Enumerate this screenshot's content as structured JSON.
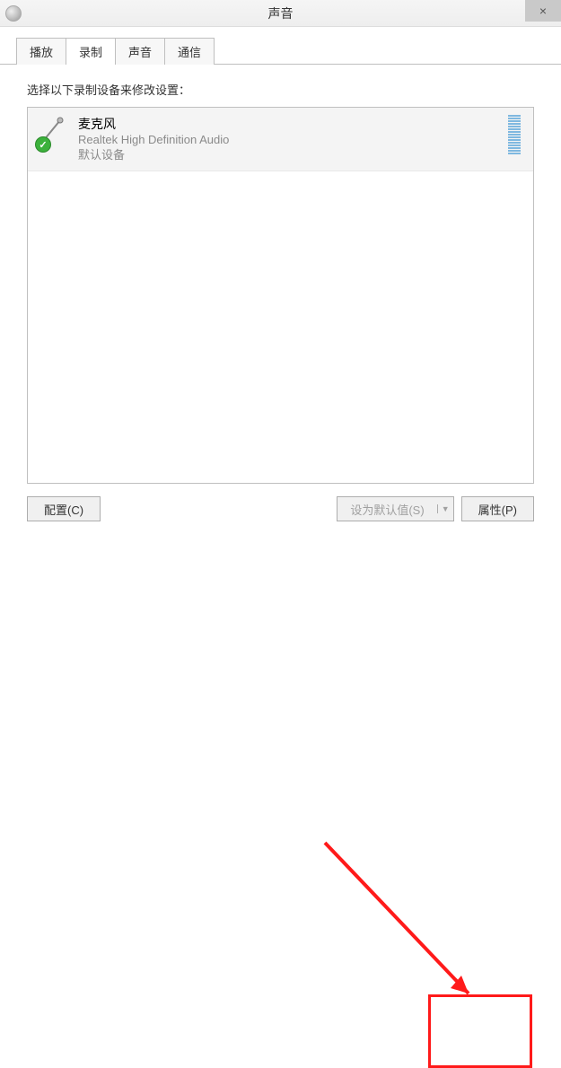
{
  "window": {
    "title": "声音",
    "close_label": "×"
  },
  "tabs": [
    {
      "label": "播放",
      "active": false
    },
    {
      "label": "录制",
      "active": true
    },
    {
      "label": "声音",
      "active": false
    },
    {
      "label": "通信",
      "active": false
    }
  ],
  "instruction": "选择以下录制设备来修改设置：",
  "devices": [
    {
      "name": "麦克风",
      "driver": "Realtek High Definition Audio",
      "status": "默认设备",
      "is_default": true
    }
  ],
  "buttons": {
    "configure": "配置(C)",
    "set_default": "设为默认值(S)",
    "properties": "属性(P)",
    "dropdown_arrow": "▼"
  }
}
